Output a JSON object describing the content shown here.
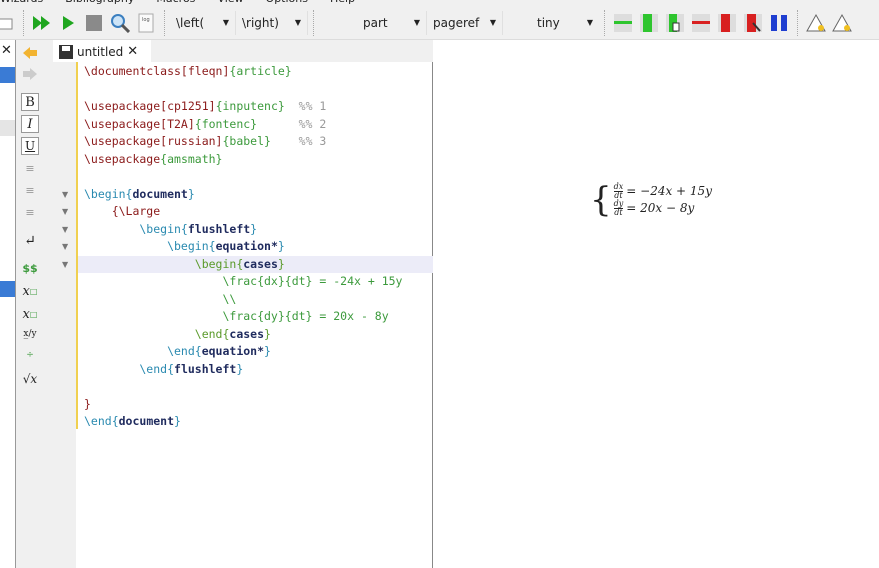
{
  "menu": [
    "Wizards",
    "Bibliography",
    "Macros",
    "View",
    "Options",
    "Help"
  ],
  "toolbar": {
    "left_delim": "\\left(",
    "right_delim": "\\right)",
    "section": "part",
    "ref": "pageref",
    "size": "tiny",
    "icons": [
      "build-and-view-icon",
      "compile-icon",
      "stop-icon",
      "view-icon",
      "log-icon"
    ],
    "table_icons": [
      "add-row-icon",
      "add-column-icon",
      "insert-column-icon",
      "remove-row-icon",
      "remove-column-icon",
      "cut-column-icon",
      "align-columns-icon",
      "warning-icon",
      "warning-icon"
    ]
  },
  "tab": {
    "title": "untitled",
    "close": "✕"
  },
  "leftpanel": {
    "close": "✕"
  },
  "sidebar_icons": {
    "bold": "B",
    "italic": "I",
    "underline": "U",
    "math": "$$"
  },
  "editor": {
    "lines": [
      [
        [
          "c",
          "\\documentclass[fleqn]"
        ],
        [
          "g",
          "{article}"
        ]
      ],
      [],
      [
        [
          "c",
          "\\usepackage[cp1251]"
        ],
        [
          "g",
          "{inputenc}"
        ],
        [
          "cm",
          "  %% 1"
        ]
      ],
      [
        [
          "c",
          "\\usepackage[T2A]"
        ],
        [
          "g",
          "{fontenc}"
        ],
        [
          "cm",
          "      %% 2"
        ]
      ],
      [
        [
          "c",
          "\\usepackage[russian]"
        ],
        [
          "g",
          "{babel}"
        ],
        [
          "cm",
          "    %% 3"
        ]
      ],
      [
        [
          "c",
          "\\usepackage"
        ],
        [
          "g",
          "{amsmath}"
        ]
      ],
      [],
      [
        [
          "b",
          "\\begin{"
        ],
        [
          "n",
          "document"
        ],
        [
          "b",
          "}"
        ]
      ],
      [
        [
          "c",
          "    {\\Large"
        ]
      ],
      [
        [
          "b",
          "        \\begin{"
        ],
        [
          "n",
          "flushleft"
        ],
        [
          "b",
          "}"
        ]
      ],
      [
        [
          "b",
          "            \\begin{"
        ],
        [
          "n",
          "equation*"
        ],
        [
          "b",
          "}"
        ]
      ],
      [
        [
          "o",
          "                \\begin{"
        ],
        [
          "n",
          "cases"
        ],
        [
          "o",
          "}"
        ]
      ],
      [
        [
          "g",
          "                    \\frac{dx}{dt} = -24x + 15y"
        ]
      ],
      [
        [
          "g",
          "                    \\\\"
        ]
      ],
      [
        [
          "g",
          "                    \\frac{dy}{dt} = 20x - 8y"
        ]
      ],
      [
        [
          "o",
          "                \\end{"
        ],
        [
          "n",
          "cases"
        ],
        [
          "o",
          "}"
        ]
      ],
      [
        [
          "b",
          "            \\end{"
        ],
        [
          "n",
          "equation*"
        ],
        [
          "b",
          "}"
        ]
      ],
      [
        [
          "b",
          "        \\end{"
        ],
        [
          "n",
          "flushleft"
        ],
        [
          "b",
          "}"
        ]
      ],
      [],
      [
        [
          "c",
          "}"
        ]
      ],
      [
        [
          "b",
          "\\end{"
        ],
        [
          "n",
          "document"
        ],
        [
          "b",
          "}"
        ]
      ]
    ]
  },
  "preview": {
    "eq1": {
      "num": "dx",
      "den": "dt",
      "rhs": "= −24x + 15y"
    },
    "eq2": {
      "num": "dy",
      "den": "dt",
      "rhs": "= 20x − 8y"
    }
  }
}
